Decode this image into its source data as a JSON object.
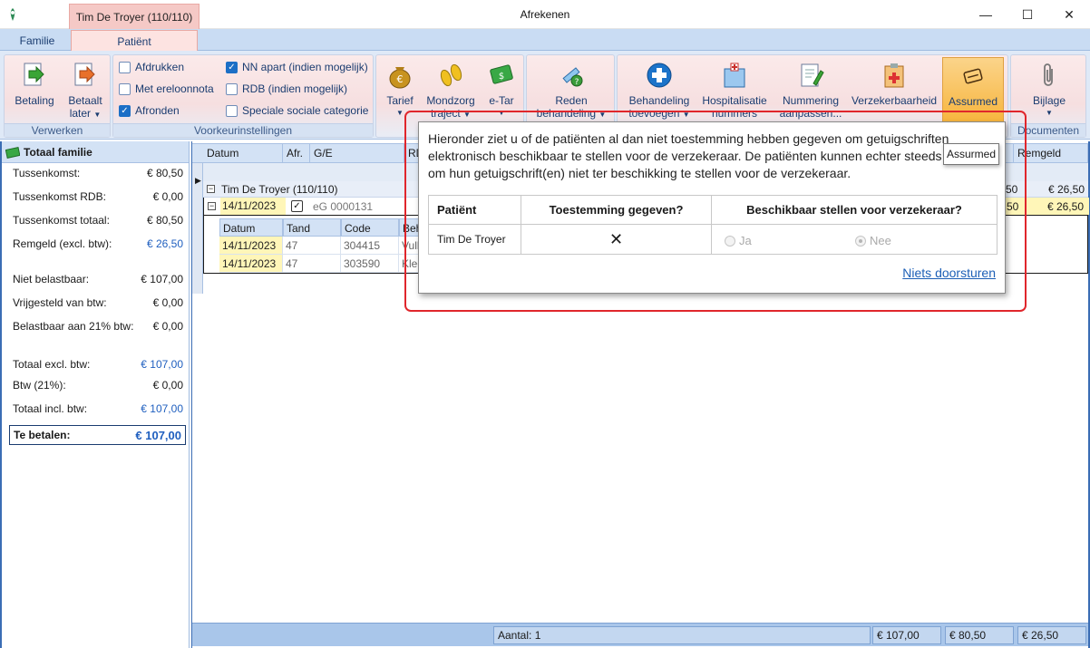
{
  "window": {
    "title": "Afrekenen",
    "context_tab": "Tim De Troyer (110/110)",
    "minimize": "—",
    "maximize": "☐",
    "close": "✕"
  },
  "ribbon_tabs": [
    "Familie",
    "Patiënt"
  ],
  "ribbon": {
    "verwerken": {
      "label": "Verwerken",
      "betaling": "Betaling",
      "betaalt_later_1": "Betaalt",
      "betaalt_later_2": "later"
    },
    "voorkeur": {
      "label": "Voorkeurinstellingen",
      "afdrukken": "Afdrukken",
      "ereloonnota": "Met ereloonnota",
      "afronden": "Afronden",
      "nn_apart": "NN apart (indien mogelijk)",
      "rdb": "RDB (indien mogelijk)",
      "speciale": "Speciale sociale categorie"
    },
    "tarief": "Tarief",
    "mondzorg_1": "Mondzorg",
    "mondzorg_2": "traject",
    "etar": "e-Tar",
    "reden_1": "Reden",
    "reden_2": "behandeling",
    "behandeling_1": "Behandeling",
    "behandeling_2": "toevoegen",
    "hosp_1": "Hospitalisatie",
    "hosp_2": "nummers",
    "nummering_1": "Nummering",
    "nummering_2": "aanpassen...",
    "verzekerbaarheid": "Verzekerbaarheid",
    "assurmed": "Assurmed",
    "bijlage": "Bijlage",
    "documenten": "Documenten"
  },
  "left_panel": {
    "header": "Totaal familie",
    "rows": [
      {
        "label": "Tussenkomst:",
        "value": "€ 80,50"
      },
      {
        "label": "Tussenkomst RDB:",
        "value": "€ 0,00"
      },
      {
        "label": "Tussenkomst totaal:",
        "value": "€ 80,50"
      },
      {
        "label": "Remgeld (excl. btw):",
        "value": "€ 26,50"
      },
      {
        "label": "Niet belastbaar:",
        "value": "€ 107,00"
      },
      {
        "label": "Vrijgesteld van btw:",
        "value": "€ 0,00"
      },
      {
        "label": "Belastbaar aan 21% btw:",
        "value": "€ 0,00"
      },
      {
        "label": "Totaal excl. btw:",
        "value": "€ 107,00"
      },
      {
        "label": "Btw (21%):",
        "value": "€ 0,00"
      },
      {
        "label": "Totaal incl. btw:",
        "value": "€ 107,00"
      }
    ],
    "te_betalen_label": "Te betalen:",
    "te_betalen_value": "€ 107,00"
  },
  "grid": {
    "headers": {
      "datum": "Datum",
      "afr": "Afr.",
      "ge": "G/E",
      "rd": "RD",
      "t": "t",
      "remgeld": "Remgeld"
    },
    "patient": "Tim De Troyer (110/110)",
    "patient_amount_a": "50",
    "patient_amount_b": "€ 26,50",
    "sub": {
      "date": "14/11/2023",
      "ge": "eG 0000131",
      "amount_a": "50",
      "amount_b": "€ 26,50"
    },
    "nested_headers": {
      "datum": "Datum",
      "tand": "Tand",
      "code": "Code",
      "beh": "Beh"
    },
    "nested_rows": [
      {
        "datum": "14/11/2023",
        "tand": "47",
        "code": "304415",
        "beh": "Vull"
      },
      {
        "datum": "14/11/2023",
        "tand": "47",
        "code": "303590",
        "beh": "Klee"
      }
    ],
    "footer": {
      "aantal": "Aantal: 1",
      "total": "€ 107,00",
      "tussenkomst": "€ 80,50",
      "remgeld": "€ 26,50"
    }
  },
  "popup": {
    "message": "Hieronder ziet u of de patiënten al dan niet toestemming hebben gegeven om getuigschriften elektronisch beschikbaar te stellen voor de verzekeraar. De patiënten kunnen echter steeds beslissen om hun getuigschrift(en) niet ter beschikking te stellen voor de verzekeraar.",
    "col_patient": "Patiënt",
    "col_toestemming": "Toestemming gegeven?",
    "col_beschikbaar": "Beschikbaar stellen voor verzekeraar?",
    "row_patient": "Tim De Troyer",
    "row_toestemming": "✕",
    "ja": "Ja",
    "nee": "Nee",
    "link": "Niets doorsturen"
  },
  "tooltip": "Assurmed"
}
